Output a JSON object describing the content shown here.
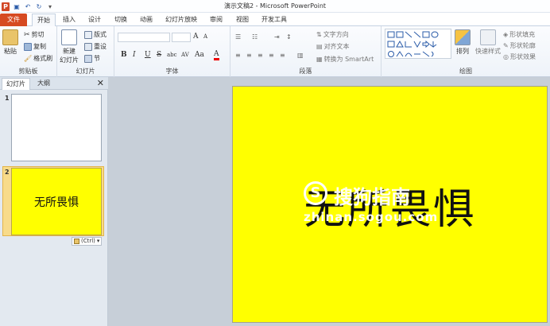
{
  "window": {
    "title": "演示文稿2 - Microsoft PowerPoint"
  },
  "tabs": [
    "文件",
    "开始",
    "插入",
    "设计",
    "切换",
    "动画",
    "幻灯片放映",
    "审阅",
    "视图",
    "开发工具"
  ],
  "ribbon": {
    "clipboard": {
      "paste": "粘贴",
      "cut": "剪切",
      "copy": "复制",
      "format_painter": "格式刷",
      "label": "剪贴板"
    },
    "slides": {
      "new_slide": "新建",
      "new_slide2": "幻灯片",
      "layout": "版式",
      "reset": "重设",
      "section": "节",
      "label": "幻灯片"
    },
    "font": {
      "bold": "B",
      "italic": "I",
      "underline": "U",
      "strike": "S",
      "shadow": "abc",
      "spacing": "AV",
      "case": "Aa",
      "color": "A",
      "grow": "A",
      "shrink": "A",
      "label": "字体"
    },
    "paragraph": {
      "text_direction": "文字方向",
      "align_text": "对齐文本",
      "smartart": "转换为 SmartArt",
      "label": "段落"
    },
    "drawing": {
      "arrange": "排列",
      "quick_styles": "快速样式",
      "shape_fill": "形状填充",
      "shape_outline": "形状轮廓",
      "shape_effects": "形状效果",
      "label": "绘图"
    }
  },
  "panel": {
    "tab_slides": "幻灯片",
    "tab_outline": "大纲",
    "close": "✕",
    "slide1_num": "1",
    "slide2_num": "2",
    "slide2_text": "无所畏惧",
    "paste_options": "(Ctrl)"
  },
  "slide": {
    "text": "无所畏惧",
    "background": "#ffff00"
  },
  "watermark": {
    "logo": "S",
    "name": "搜狗指南",
    "url": "zhinan.sogou.com"
  },
  "colors": {
    "file_tab": "#d64a21",
    "accent": "#2a5ba8"
  }
}
